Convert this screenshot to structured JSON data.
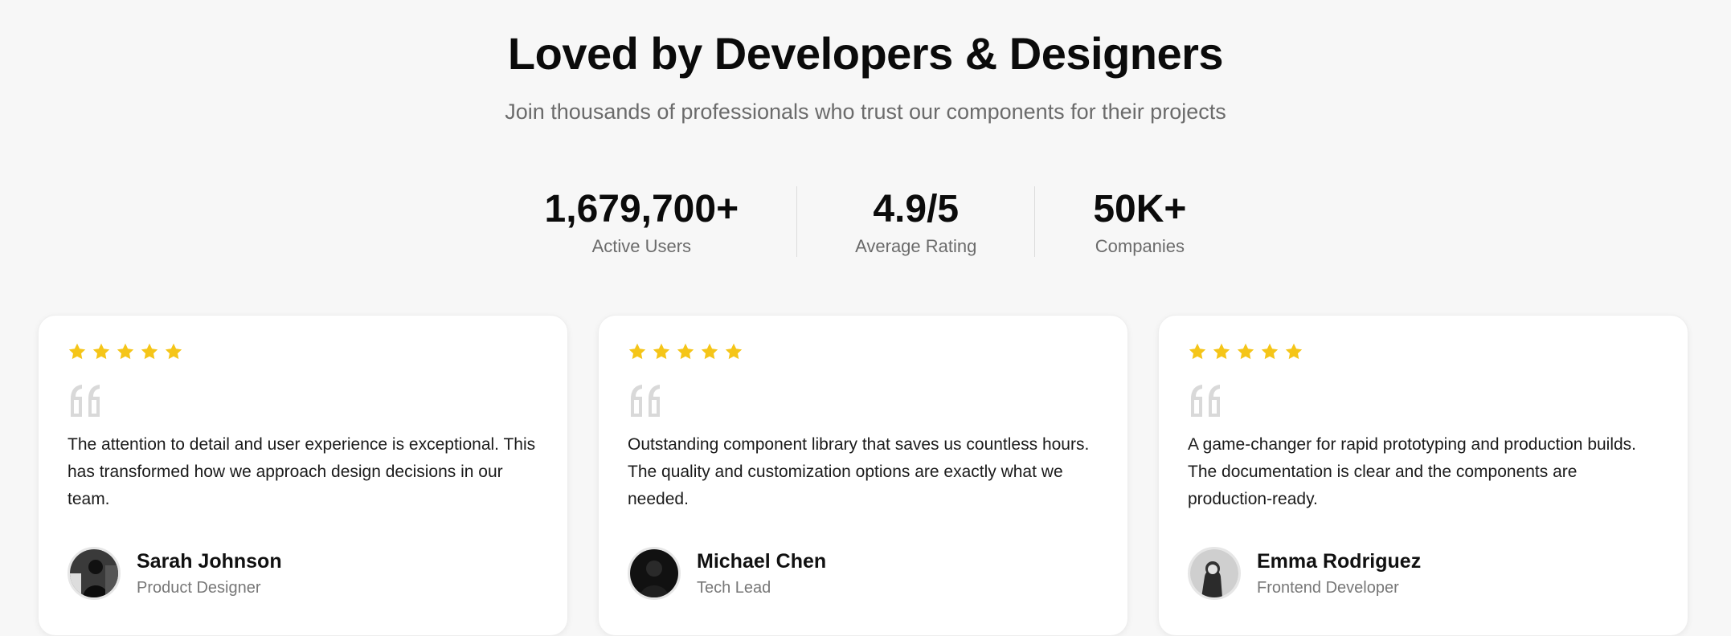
{
  "header": {
    "title": "Loved by Developers & Designers",
    "subtitle": "Join thousands of professionals who trust our components for their projects"
  },
  "stats": [
    {
      "value": "1,679,700+",
      "label": "Active Users"
    },
    {
      "value": "4.9/5",
      "label": "Average Rating"
    },
    {
      "value": "50K+",
      "label": "Companies"
    }
  ],
  "colors": {
    "star": "#f5c518",
    "quote_icon": "#d9d9d9"
  },
  "testimonials": [
    {
      "rating": 5,
      "icons": [
        "star-icon",
        "quote-icon"
      ],
      "text": "The attention to detail and user experience is exceptional. This has transformed how we approach design decisions in our team.",
      "name": "Sarah Johnson",
      "role": "Product Designer"
    },
    {
      "rating": 5,
      "icons": [
        "star-icon",
        "quote-icon"
      ],
      "text": "Outstanding component library that saves us countless hours. The quality and customization options are exactly what we needed.",
      "name": "Michael Chen",
      "role": "Tech Lead"
    },
    {
      "rating": 5,
      "icons": [
        "star-icon",
        "quote-icon"
      ],
      "text": "A game-changer for rapid prototyping and production builds. The documentation is clear and the components are production-ready.",
      "name": "Emma Rodriguez",
      "role": "Frontend Developer"
    }
  ]
}
